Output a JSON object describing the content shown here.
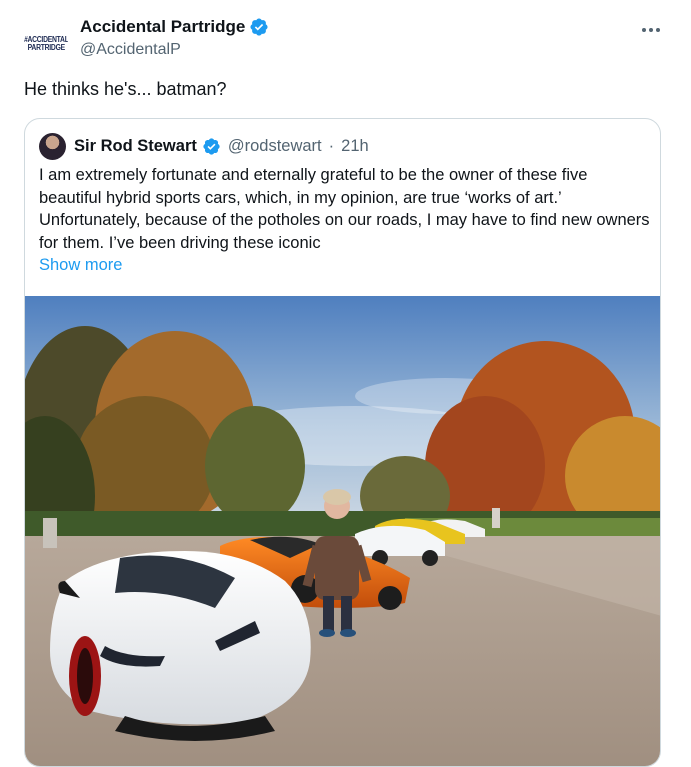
{
  "tweet": {
    "avatar_logo": "#ACCIDENTAL\nPARTRIDGE",
    "display_name": "Accidental Partridge",
    "handle": "@AccidentalP",
    "text": "He thinks he's... batman?"
  },
  "quoted": {
    "display_name": "Sir Rod Stewart",
    "handle": "@rodstewart",
    "separator": "·",
    "time": "21h",
    "text": "I am extremely fortunate and eternally grateful to be the owner of these five beautiful hybrid sports cars, which, in my opinion, are true ‘works of art.’ Unfortunately, because of the potholes on our roads, I may have to find new owners for them. I’ve been driving these iconic",
    "show_more": "Show more"
  },
  "colors": {
    "verified": "#1d9bf0",
    "link": "#1d9bf0",
    "secondary_text": "#536471",
    "border": "#cfd9de"
  },
  "icons": {
    "verified": "verified-badge-icon",
    "more": "more-dots-icon"
  }
}
